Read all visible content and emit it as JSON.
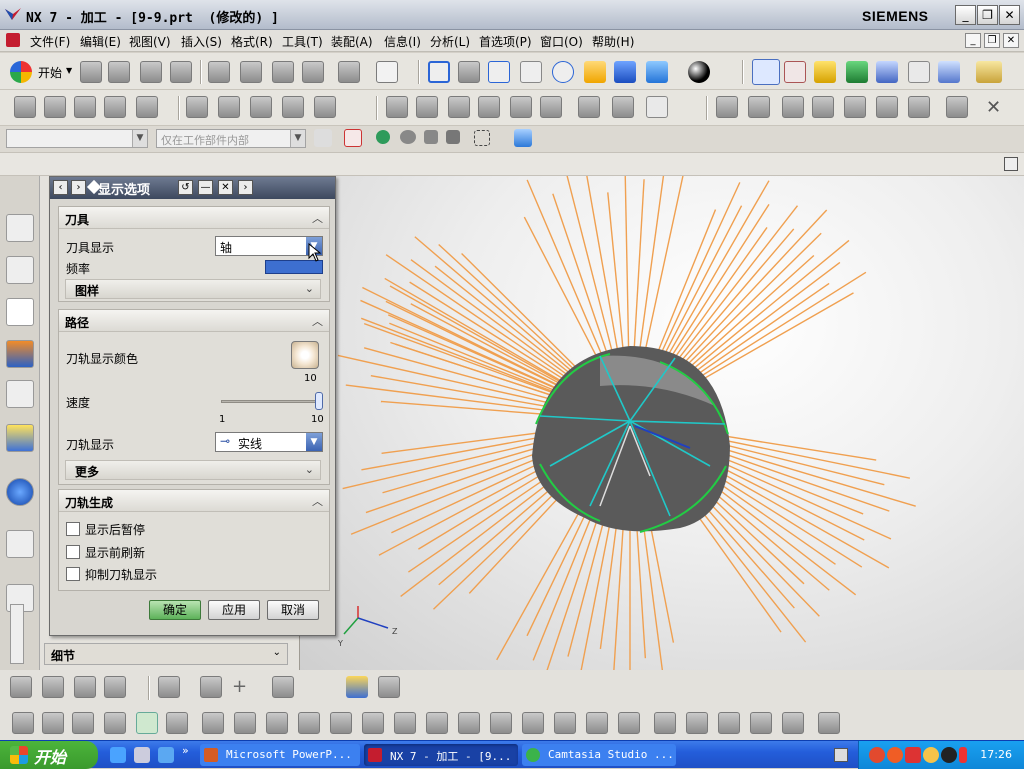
{
  "app": {
    "title": "NX 7 - 加工 - [9-9.prt  (修改的) ]",
    "brand": "SIEMENS"
  },
  "window_controls": {
    "minimize": "_",
    "restore": "❐",
    "close": "✕"
  },
  "menu": [
    "文件(F)",
    "编辑(E)",
    "视图(V)",
    "插入(S)",
    "格式(R)",
    "工具(T)",
    "装配(A)",
    "信息(I)",
    "分析(L)",
    "首选项(P)",
    "窗口(O)",
    "帮助(H)"
  ],
  "toolbar": {
    "start_label": "开始"
  },
  "selection": {
    "filter_value": "",
    "scope_value": "仅在工作部件内部"
  },
  "dialog": {
    "title": "显示选项",
    "tool_group": {
      "header": "刀具",
      "display_label": "刀具显示",
      "display_value": "轴",
      "frequency_label": "频率",
      "pattern_label": "图样"
    },
    "path_group": {
      "header": "路径",
      "color_label": "刀轨显示颜色",
      "speed_label": "速度",
      "speed_value": "10",
      "speed_min": "1",
      "speed_max": "10",
      "speed_fraction": 1.0,
      "path_display_label": "刀轨显示",
      "path_display_value": "实线",
      "more_label": "更多"
    },
    "gen_group": {
      "header": "刀轨生成",
      "options": [
        "显示后暂停",
        "显示前刷新",
        "抑制刀轨显示"
      ]
    },
    "buttons": {
      "ok": "确定",
      "apply": "应用",
      "cancel": "取消"
    }
  },
  "navigator": {
    "detail_label": "细节"
  },
  "triad": {
    "z_label": "Z",
    "y_label": "Y"
  },
  "colors": {
    "tool_axes": "#f0a050",
    "part": "#555555",
    "edge_highlight": "#22cc44",
    "path": "#20c8c8"
  },
  "taskbar": {
    "start_label": "开始",
    "tasks": [
      "Microsoft PowerP...",
      "NX 7 - 加工 - [9...",
      "Camtasia Studio ..."
    ],
    "clock": "17:26"
  }
}
